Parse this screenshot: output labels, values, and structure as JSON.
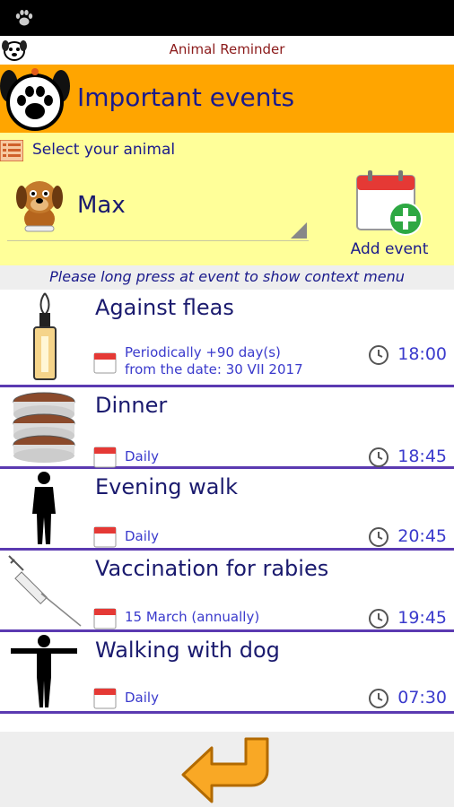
{
  "app": {
    "title": "Animal Reminder"
  },
  "header": {
    "title": "Important events"
  },
  "selector": {
    "label": "Select your animal",
    "selected_animal": "Max"
  },
  "add_event": {
    "label": "Add event"
  },
  "hint": "Please long press at event to show context menu",
  "events": [
    {
      "title": "Against fleas",
      "schedule_line1": "Periodically +90 day(s)",
      "schedule_line2": "from the date: 30 VII 2017",
      "time": "18:00",
      "image": "flea-bottle-icon"
    },
    {
      "title": "Dinner",
      "schedule_line1": "Daily",
      "time": "18:45",
      "image": "food-bowls-icon"
    },
    {
      "title": "Evening walk",
      "schedule_line1": "Daily",
      "time": "20:45",
      "image": "person-walking-icon"
    },
    {
      "title": "Vaccination for rabies",
      "schedule_line1": "15 March (annually)",
      "time": "19:45",
      "image": "syringe-icon"
    },
    {
      "title": "Walking with dog",
      "schedule_line1": "Daily",
      "time": "07:30",
      "image": "person-arms-out-icon"
    }
  ],
  "colors": {
    "header_bg": "#ffa500",
    "panel_bg": "#ffff99",
    "title_text": "#1a1a8c",
    "detail_text": "#3a3acc",
    "divider": "#5b3ab1"
  }
}
